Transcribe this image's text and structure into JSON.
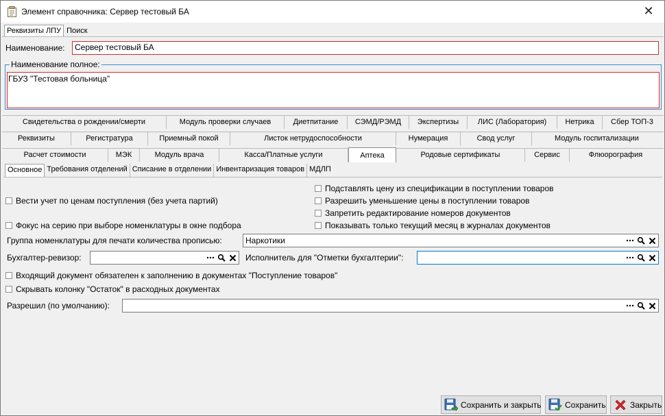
{
  "window": {
    "title": "Элемент справочника: Сервер тестовый БА"
  },
  "top_tabs": [
    "Реквизиты ЛПУ",
    "Поиск"
  ],
  "name": {
    "label": "Наименование:",
    "value": "Сервер тестовый БА"
  },
  "full_name": {
    "label": "Наименование полное:",
    "value": "ГБУЗ \"Тестовая больница\""
  },
  "tab_rows": [
    [
      "Свидетельства о рождении/смерти",
      "Модуль проверки случаев",
      "Диетпитание",
      "СЭМД/РЭМД",
      "Экспертизы",
      "ЛИС (Лаборатория)",
      "Нетрика",
      "Сбер ТОП-3"
    ],
    [
      "Реквизиты",
      "Регистратура",
      "Приемный покой",
      "Листок нетрудоспособности",
      "Нумерация",
      "Свод услуг",
      "Модуль госпитализации"
    ],
    [
      "Расчет стоимости",
      "МЭК",
      "Модуль врача",
      "Касса/Платные услуги",
      "Аптека",
      "Родовые сертификаты",
      "Сервис",
      "Флюорография"
    ]
  ],
  "sub_tabs": [
    "Основное",
    "Требования отделений",
    "Списание в отделении",
    "Инвентаризация товаров",
    "МДЛП"
  ],
  "checkboxes": {
    "use_purchase_prices": "Вести учет по ценам поступления (без учета партий)",
    "focus_series": "Фокус на серию при выборе номенклатуры в окне подбора",
    "substitute_price": "Подставлять цену из спецификации в поступлении товаров",
    "allow_price_decrease": "Разрешить уменьшение цены в поступлении товаров",
    "forbid_edit_numbers": "Запретить редактирование номеров документов",
    "show_current_month": "Показывать только текущий месяц в журналах документов",
    "incoming_doc_required": "Входящий документ обязателен к заполнению в документах \"Поступление товаров\"",
    "hide_balance_column": "Скрывать колонку \"Остаток\" в расходных документах"
  },
  "fields": {
    "nomenclature_group": {
      "label": "Группа номенклатуры для печати количества прописью:",
      "value": "Наркотики"
    },
    "auditor": {
      "label": "Бухгалтер-ревизор:",
      "value": ""
    },
    "executor": {
      "label": "Исполнитель для \"Отметки бухгалтерии\":",
      "value": ""
    },
    "approved_by": {
      "label": "Разрешил (по умолчанию):",
      "value": ""
    }
  },
  "buttons": {
    "save_close": "Сохранить и закрыть",
    "save": "Сохранить",
    "close": "Закрыть"
  },
  "icons": [
    "document-icon",
    "close-icon",
    "ellipsis-icon",
    "magnifier-icon",
    "clear-icon",
    "floppy-save-close-icon",
    "floppy-save-icon",
    "red-x-icon"
  ],
  "colors": {
    "error_border": "#d62a2a",
    "focus_border": "#0078d7",
    "group_border": "#3a8cd4"
  }
}
